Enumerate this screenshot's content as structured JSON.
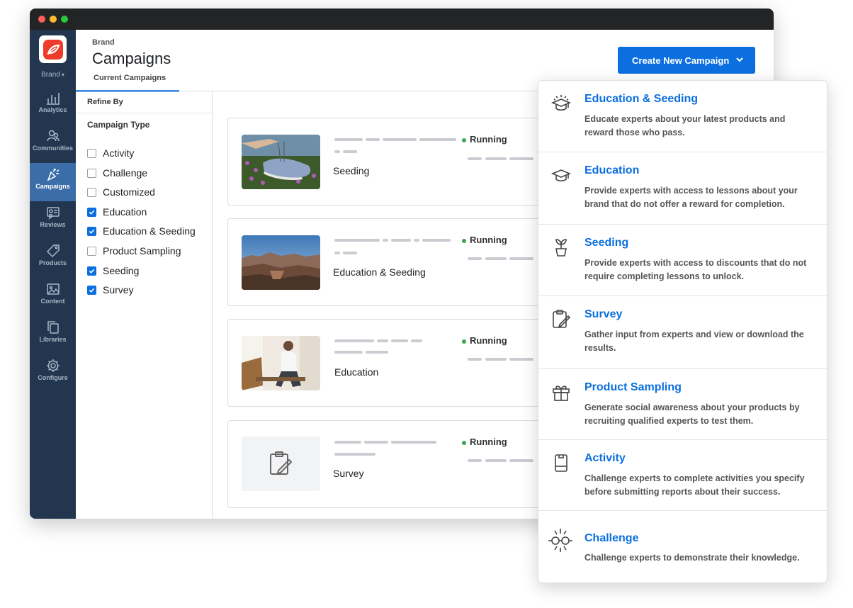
{
  "sidebar": {
    "brand_label": "Brand",
    "items": [
      {
        "label": "Analytics",
        "icon": "bar-chart-icon"
      },
      {
        "label": "Communities",
        "icon": "people-icon"
      },
      {
        "label": "Campaigns",
        "icon": "party-popper-icon",
        "active": true
      },
      {
        "label": "Reviews",
        "icon": "reviews-icon"
      },
      {
        "label": "Products",
        "icon": "tag-icon"
      },
      {
        "label": "Content",
        "icon": "image-icon"
      },
      {
        "label": "Libraries",
        "icon": "copy-icon"
      },
      {
        "label": "Configure",
        "icon": "gear-icon"
      }
    ]
  },
  "header": {
    "breadcrumb": "Brand",
    "title": "Campaigns",
    "tab": "Current Campaigns",
    "create_button": "Create New Campaign"
  },
  "filter": {
    "refine_label": "Refine By",
    "group_label": "Campaign Type",
    "options": [
      {
        "label": "Activity",
        "checked": false
      },
      {
        "label": "Challenge",
        "checked": false
      },
      {
        "label": "Customized",
        "checked": false
      },
      {
        "label": "Education",
        "checked": true
      },
      {
        "label": "Education & Seeding",
        "checked": true
      },
      {
        "label": "Product Sampling",
        "checked": false
      },
      {
        "label": "Seeding",
        "checked": true
      },
      {
        "label": "Survey",
        "checked": true
      }
    ]
  },
  "campaigns": [
    {
      "name": "Seeding",
      "status": "Running",
      "thumb": "shoe-photo"
    },
    {
      "name": "Education & Seeding",
      "status": "Running",
      "thumb": "canyon-photo"
    },
    {
      "name": "Education",
      "status": "Running",
      "thumb": "person-photo"
    },
    {
      "name": "Survey",
      "status": "Running",
      "thumb": "clipboard-icon"
    }
  ],
  "menu": [
    {
      "title": "Education & Seeding",
      "desc": "Educate experts about your latest products and reward those who pass.",
      "icon": "graduation-cap-sparkle-icon"
    },
    {
      "title": "Education",
      "desc": "Provide experts with access to lessons about your brand that do not offer a reward for completion.",
      "icon": "graduation-cap-icon"
    },
    {
      "title": "Seeding",
      "desc": "Provide experts with access to discounts that do not require completing lessons to unlock.",
      "icon": "sprout-pot-icon"
    },
    {
      "title": "Survey",
      "desc": "Gather input from experts and view or download the results.",
      "icon": "clipboard-pen-icon"
    },
    {
      "title": "Product Sampling",
      "desc": "Generate social awareness about your products by recruiting qualified experts to test them.",
      "icon": "gift-icon"
    },
    {
      "title": "Activity",
      "desc": "Challenge experts to complete activities you specify before submitting reports about their success.",
      "icon": "device-icon"
    },
    {
      "title": "Challenge",
      "desc": "Challenge experts to demonstrate their knowledge.",
      "icon": "challenge-icon"
    }
  ],
  "colors": {
    "accent": "#0b6fe0",
    "sidebar": "#22364f",
    "active_nav": "#3b6ea8",
    "running": "#3aa655"
  }
}
